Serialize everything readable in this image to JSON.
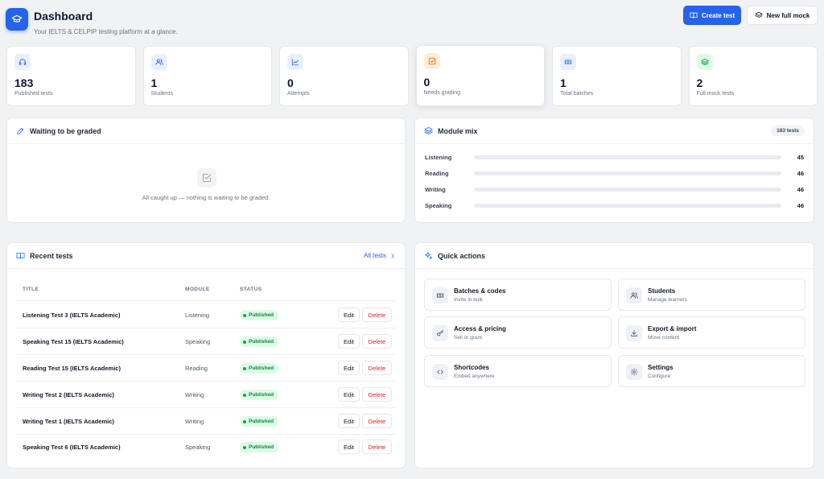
{
  "header": {
    "title": "Dashboard",
    "subtitle": "Your IELTS & CELPIP testing platform at a glance.",
    "create_label": "Create test",
    "mock_label": "New full mock"
  },
  "stats": [
    {
      "value": "183",
      "label": "Published tests",
      "icon": "headphones-icon",
      "color": "#2563eb",
      "bg": "#e8f0fe"
    },
    {
      "value": "1",
      "label": "Students",
      "icon": "users-icon",
      "color": "#2563eb",
      "bg": "#e8f0fe"
    },
    {
      "value": "0",
      "label": "Attempts",
      "icon": "chart-icon",
      "color": "#2563eb",
      "bg": "#e8f0fe"
    },
    {
      "value": "0",
      "label": "Needs grading",
      "icon": "check-square-icon",
      "color": "#ea580c",
      "bg": "#ffedd5"
    },
    {
      "value": "1",
      "label": "Total batches",
      "icon": "ticket-icon",
      "color": "#2563eb",
      "bg": "#e8f0fe"
    },
    {
      "value": "2",
      "label": "Full mock tests",
      "icon": "layers-icon",
      "color": "#16a34a",
      "bg": "#dcfce7"
    }
  ],
  "waiting": {
    "title": "Waiting to be graded",
    "empty_text": "All caught up — nothing is waiting to be graded."
  },
  "module_mix": {
    "title": "Module mix",
    "total_badge": "183 tests",
    "items": [
      {
        "name": "Listening",
        "value": "45"
      },
      {
        "name": "Reading",
        "value": "46"
      },
      {
        "name": "Writing",
        "value": "46"
      },
      {
        "name": "Speaking",
        "value": "46"
      }
    ]
  },
  "recent": {
    "title": "Recent tests",
    "all_link": "All tests",
    "columns": [
      "TITLE",
      "MODULE",
      "STATUS"
    ],
    "edit_label": "Edit",
    "delete_label": "Delete",
    "rows": [
      {
        "title": "Listening Test 3 (IELTS Academic)",
        "module": "Listening",
        "status": "Published"
      },
      {
        "title": "Speaking Test 15 (IELTS Academic)",
        "module": "Speaking",
        "status": "Published"
      },
      {
        "title": "Reading Test 15 (IELTS Academic)",
        "module": "Reading",
        "status": "Published"
      },
      {
        "title": "Writing Test 2 (IELTS Academic)",
        "module": "Writing",
        "status": "Published"
      },
      {
        "title": "Writing Test 1 (IELTS Academic)",
        "module": "Writing",
        "status": "Published"
      },
      {
        "title": "Speaking Test 6 (IELTS Academic)",
        "module": "Speaking",
        "status": "Published"
      }
    ]
  },
  "quick": {
    "title": "Quick actions",
    "items": [
      {
        "title": "Batches & codes",
        "sub": "Invite in bulk",
        "icon": "ticket-icon"
      },
      {
        "title": "Students",
        "sub": "Manage learners",
        "icon": "users-icon"
      },
      {
        "title": "Access & pricing",
        "sub": "Sell or grant",
        "icon": "key-icon"
      },
      {
        "title": "Export & import",
        "sub": "Move content",
        "icon": "download-icon"
      },
      {
        "title": "Shortcodes",
        "sub": "Embed anywhere",
        "icon": "code-icon"
      },
      {
        "title": "Settings",
        "sub": "Configure",
        "icon": "gear-icon"
      }
    ]
  }
}
